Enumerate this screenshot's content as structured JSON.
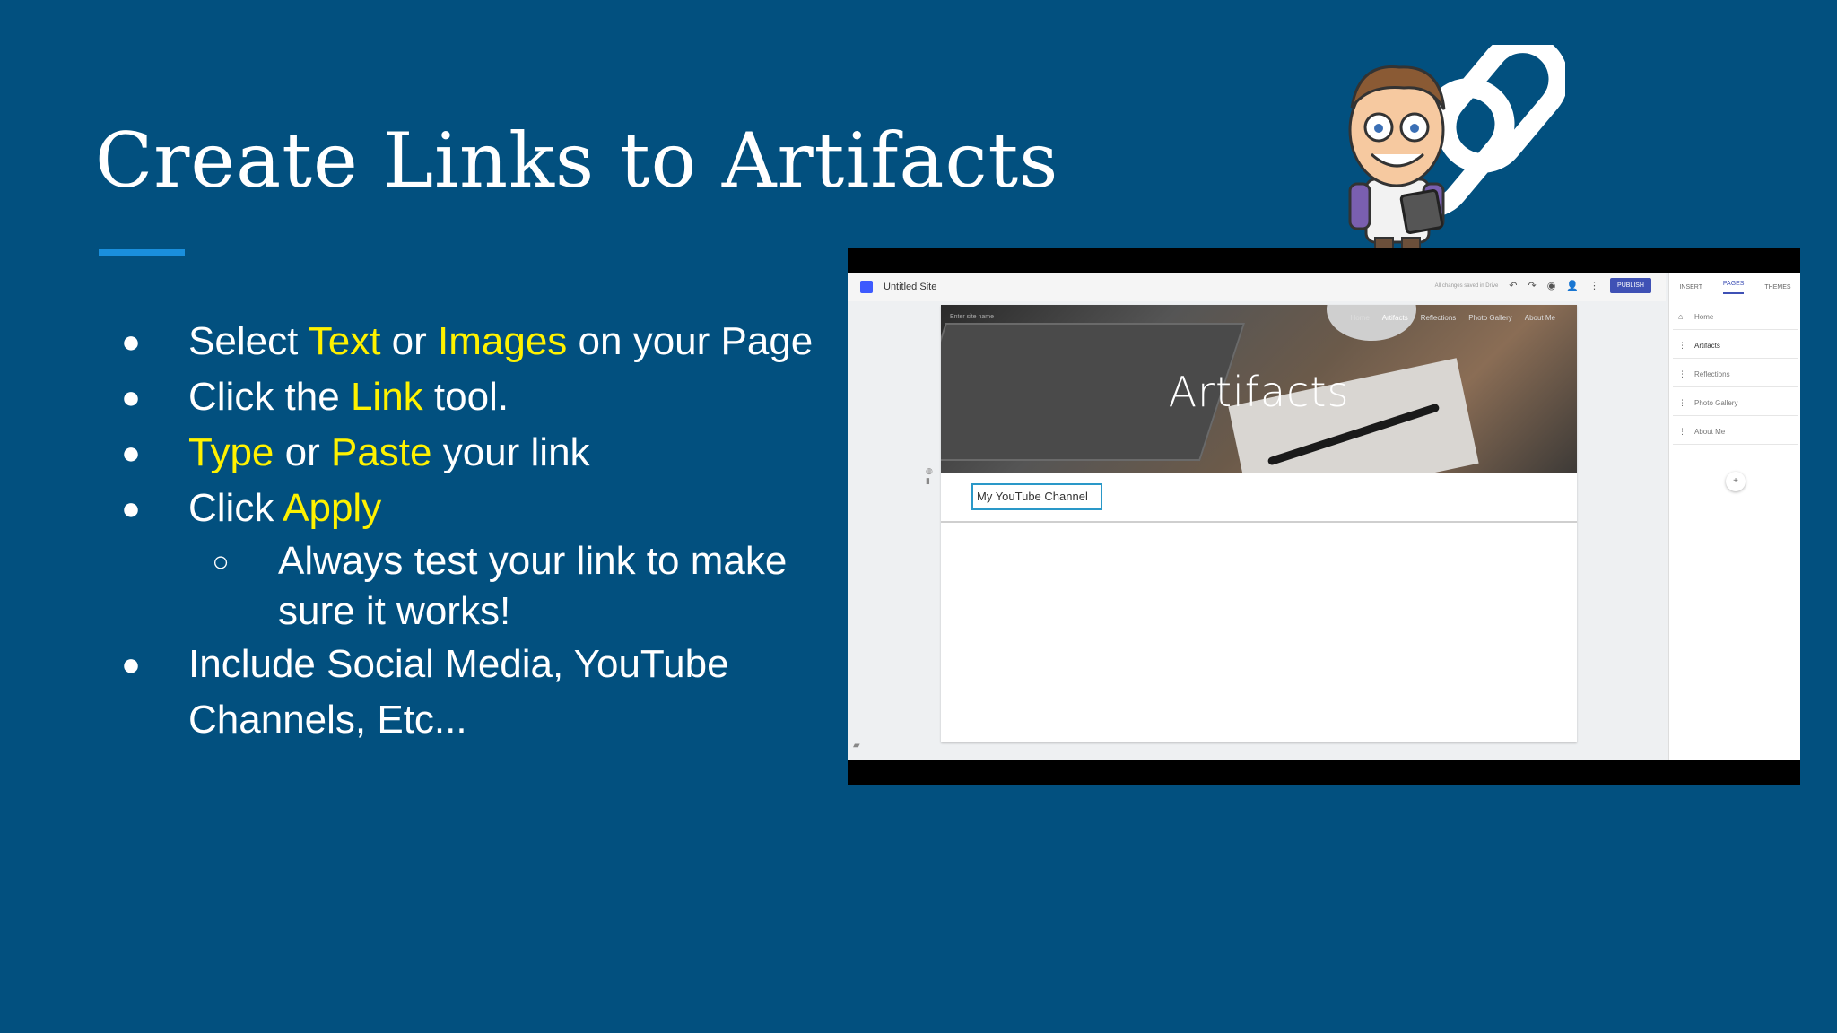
{
  "slide": {
    "title": "Create Links to Artifacts",
    "bullets": [
      {
        "parts": [
          {
            "text": "Select ",
            "hl": false
          },
          {
            "text": "Text",
            "hl": true
          },
          {
            "text": " or ",
            "hl": false
          },
          {
            "text": "Images",
            "hl": true
          },
          {
            "text": " on your Page",
            "hl": false
          }
        ]
      },
      {
        "parts": [
          {
            "text": "Click the ",
            "hl": false
          },
          {
            "text": "Link",
            "hl": true
          },
          {
            "text": " tool.",
            "hl": false
          }
        ]
      },
      {
        "parts": [
          {
            "text": "Type",
            "hl": true
          },
          {
            "text": " or ",
            "hl": false
          },
          {
            "text": "Paste",
            "hl": true
          },
          {
            "text": " your link",
            "hl": false
          }
        ]
      },
      {
        "parts": [
          {
            "text": "Click ",
            "hl": false
          },
          {
            "text": "Apply",
            "hl": true
          }
        ]
      }
    ],
    "sub_bullet": "Always test your link to make sure it works!",
    "last_bullet": "Include Social Media, YouTube Channels, Etc...",
    "bullet_glyph": "●",
    "sub_bullet_glyph": "○"
  },
  "colors": {
    "background": "#02507f",
    "highlight": "#fff200",
    "title_rule": "#1a8fdd",
    "publish": "#3f51b5",
    "selection_border": "#2a98c8"
  },
  "screenshot": {
    "site_name": "Untitled Site",
    "toolbar_status": "All changes saved in Drive",
    "publish_label": "PUBLISH",
    "panel_tabs": [
      "INSERT",
      "PAGES",
      "THEMES"
    ],
    "active_panel_tab": "PAGES",
    "pages": [
      "Home",
      "Artifacts",
      "Reflections",
      "Photo Gallery",
      "About Me"
    ],
    "selected_page": "Artifacts",
    "banner_overline": "Enter site name",
    "nav_items": [
      "Home",
      "Artifacts",
      "Reflections",
      "Photo Gallery",
      "About Me"
    ],
    "active_nav": "Artifacts",
    "banner_title": "Artifacts",
    "text_box_value": "My YouTube Channel",
    "icons": {
      "undo": "undo-icon",
      "redo": "redo-icon",
      "preview": "eye-icon",
      "share": "add-person-icon",
      "more": "more-vertical-icon",
      "home": "home-icon",
      "add_page": "add-page-icon"
    }
  }
}
